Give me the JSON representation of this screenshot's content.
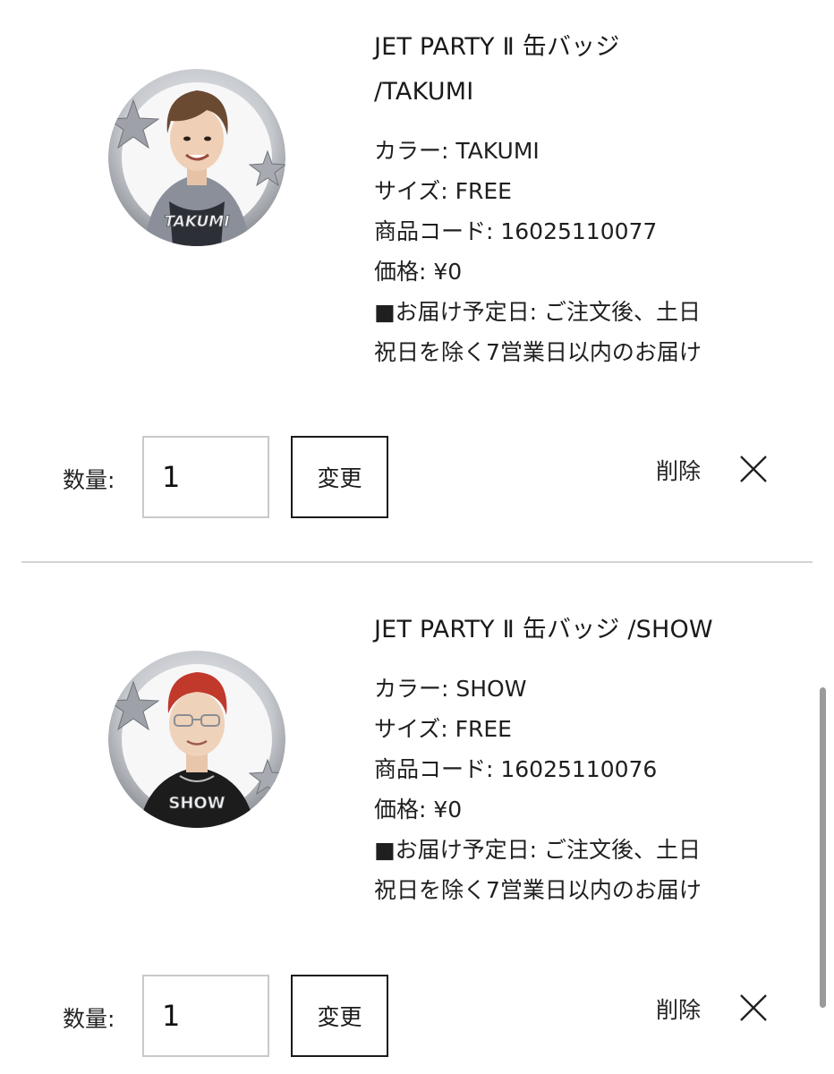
{
  "items": [
    {
      "title": "JET PARTY Ⅱ 缶バッジ /TAKUMI",
      "title_line1": "JET PARTY Ⅱ 缶バッジ",
      "title_line2": "/TAKUMI",
      "badge_name": "TAKUMI",
      "color": "カラー: TAKUMI",
      "size": "サイズ: FREE",
      "code": "商品コード: 16025110077",
      "price": "価格: ¥0",
      "delivery_line1": "■お届け予定日: ご注文後、土日",
      "delivery_line2": "祝日を除く7営業日以内のお届け",
      "quantity_label": "数量:",
      "quantity_value": "1",
      "change_label": "変更",
      "delete_label": "削除",
      "hair_color": "#6b4a32",
      "outfit_color": "#8a8f99"
    },
    {
      "title": "JET PARTY Ⅱ 缶バッジ /SHOW",
      "badge_name": "SHOW",
      "color": "カラー: SHOW",
      "size": "サイズ: FREE",
      "code": "商品コード: 16025110076",
      "price": "価格: ¥0",
      "delivery_line1": "■お届け予定日: ご注文後、土日",
      "delivery_line2": "祝日を除く7営業日以内のお届け",
      "quantity_label": "数量:",
      "quantity_value": "1",
      "change_label": "変更",
      "delete_label": "削除",
      "hair_color": "#c0392b",
      "outfit_color": "#1c1c1c"
    }
  ],
  "icons": {
    "close": "close-icon",
    "badge": "badge-image"
  },
  "colors": {
    "divider": "#d4d4d4",
    "input_border": "#c9c9c9",
    "button_border": "#1a1a1a",
    "scrollbar": "#9a9a9a",
    "badge_ring": "#b9bcc2"
  }
}
